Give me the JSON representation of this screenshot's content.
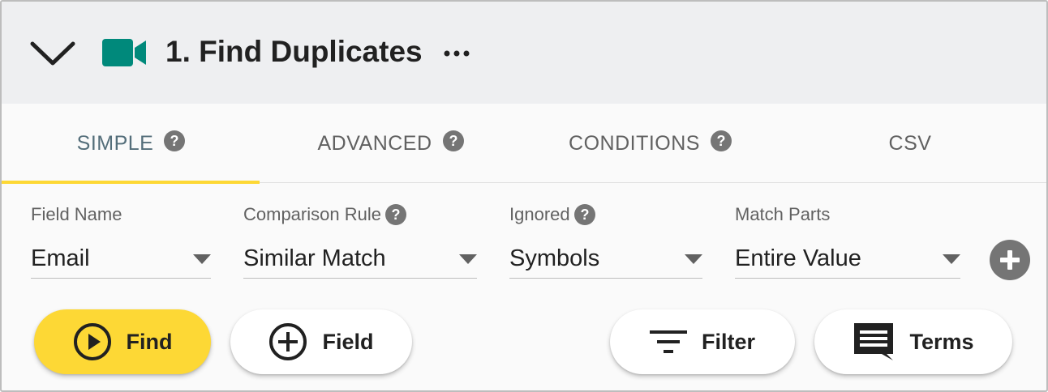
{
  "header": {
    "title": "1. Find Duplicates",
    "collapse_icon": "chevron-down-icon",
    "step_icon": "video-camera-icon",
    "more_icon": "more-horizontal-icon"
  },
  "tabs": [
    {
      "label": "SIMPLE",
      "active": true,
      "help": true
    },
    {
      "label": "ADVANCED",
      "active": false,
      "help": true
    },
    {
      "label": "CONDITIONS",
      "active": false,
      "help": true
    },
    {
      "label": "CSV",
      "active": false,
      "help": false
    }
  ],
  "fields": [
    {
      "label": "Field Name",
      "value": "Email",
      "help": false
    },
    {
      "label": "Comparison Rule",
      "value": "Similar Match",
      "help": true
    },
    {
      "label": "Ignored",
      "value": "Symbols",
      "help": true
    },
    {
      "label": "Match Parts",
      "value": "Entire Value",
      "help": false
    }
  ],
  "buttons": {
    "find": "Find",
    "field": "Field",
    "filter": "Filter",
    "terms": "Terms"
  },
  "colors": {
    "accent": "#fdd835",
    "step_icon": "#00897b",
    "active_tab_text": "#546e7a",
    "help_icon": "#757575"
  }
}
